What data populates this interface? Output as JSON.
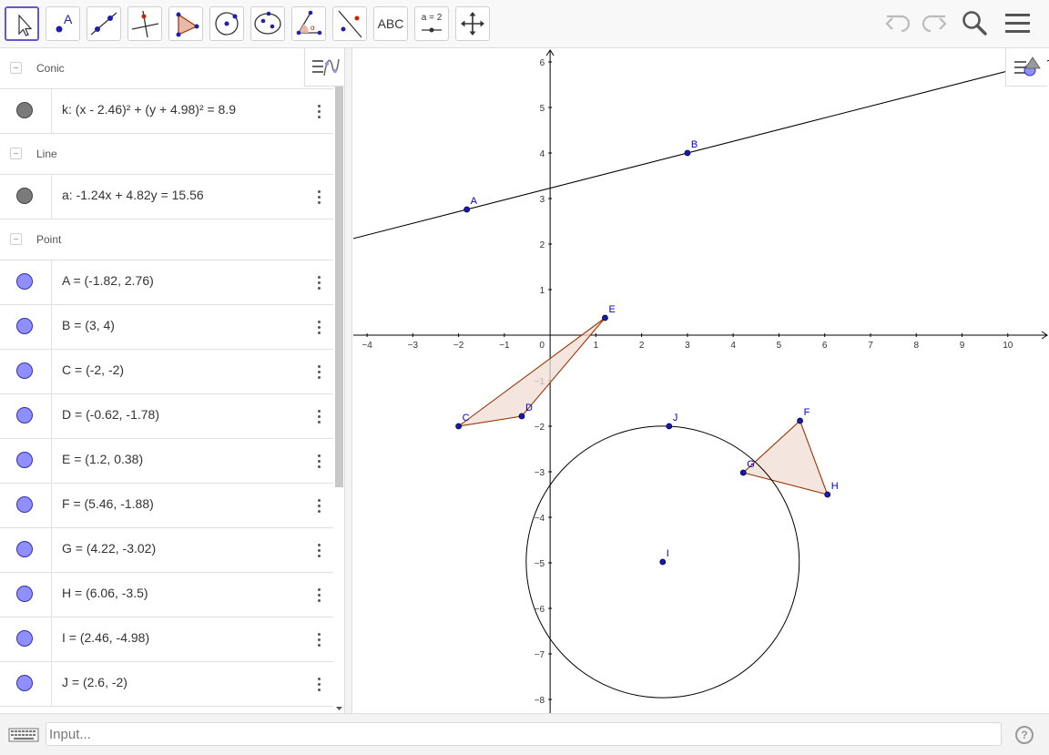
{
  "toolbar": {
    "tools": [
      {
        "name": "move-tool",
        "selected": true
      },
      {
        "name": "point-tool"
      },
      {
        "name": "line-tool"
      },
      {
        "name": "perpendicular-line-tool"
      },
      {
        "name": "polygon-tool"
      },
      {
        "name": "circle-center-point-tool"
      },
      {
        "name": "ellipse-tool"
      },
      {
        "name": "angle-tool"
      },
      {
        "name": "reflect-line-tool"
      },
      {
        "name": "text-tool",
        "label": "ABC"
      },
      {
        "name": "slider-tool",
        "label": "a = 2"
      },
      {
        "name": "move-graphics-view-tool"
      }
    ],
    "icons": {
      "undo": "undo-icon",
      "redo": "redo-icon",
      "search": "search-icon",
      "menu": "menu-icon"
    }
  },
  "algebra": {
    "groups": [
      {
        "title": "Conic",
        "items": [
          {
            "expr": "k: (x - 2.46)² + (y + 4.98)² = 8.9",
            "color": "gray"
          }
        ]
      },
      {
        "title": "Line",
        "items": [
          {
            "expr": "a: -1.24x + 4.82y = 15.56",
            "color": "gray"
          }
        ]
      },
      {
        "title": "Point",
        "items": [
          {
            "expr": "A = (-1.82, 2.76)",
            "color": "blue"
          },
          {
            "expr": "B = (3, 4)",
            "color": "blue"
          },
          {
            "expr": "C = (-2, -2)",
            "color": "blue"
          },
          {
            "expr": "D = (-0.62, -1.78)",
            "color": "blue"
          },
          {
            "expr": "E = (1.2, 0.38)",
            "color": "blue"
          },
          {
            "expr": "F = (5.46, -1.88)",
            "color": "blue"
          },
          {
            "expr": "G = (4.22, -3.02)",
            "color": "blue"
          },
          {
            "expr": "H = (6.06, -3.5)",
            "color": "blue"
          },
          {
            "expr": "I = (2.46, -4.98)",
            "color": "blue"
          },
          {
            "expr": "J = (2.6, -2)",
            "color": "blue"
          }
        ]
      }
    ]
  },
  "graphics": {
    "x_range": [
      -4.3,
      10.9
    ],
    "y_range": [
      -8.3,
      6.3
    ],
    "x_ticks": [
      "−4",
      "−3",
      "−2",
      "−1",
      "0",
      "1",
      "2",
      "3",
      "4",
      "5",
      "6",
      "7",
      "8",
      "9",
      "10"
    ],
    "y_ticks": [
      "6",
      "5",
      "4",
      "3",
      "2",
      "1",
      "−1",
      "−2",
      "−3",
      "−4",
      "−5",
      "−6",
      "−7",
      "−8"
    ],
    "points": [
      {
        "label": "A",
        "x": -1.82,
        "y": 2.76
      },
      {
        "label": "B",
        "x": 3,
        "y": 4
      },
      {
        "label": "C",
        "x": -2,
        "y": -2
      },
      {
        "label": "D",
        "x": -0.62,
        "y": -1.78
      },
      {
        "label": "E",
        "x": 1.2,
        "y": 0.38
      },
      {
        "label": "F",
        "x": 5.46,
        "y": -1.88
      },
      {
        "label": "G",
        "x": 4.22,
        "y": -3.02
      },
      {
        "label": "H",
        "x": 6.06,
        "y": -3.5
      },
      {
        "label": "I",
        "x": 2.46,
        "y": -4.98
      },
      {
        "label": "J",
        "x": 2.6,
        "y": -2
      }
    ],
    "line": {
      "name": "a",
      "through": [
        "A",
        "B"
      ]
    },
    "circle": {
      "name": "k",
      "center": [
        2.46,
        -4.98
      ],
      "r_squared": 8.9
    },
    "polygons": [
      [
        "C",
        "D",
        "E"
      ],
      [
        "G",
        "F",
        "H"
      ]
    ],
    "colors": {
      "point": "#0000cc",
      "point_fill": "#1a1aa8",
      "polygon_stroke": "#993300",
      "polygon_fill": "#f0dcd3",
      "axis": "#000000"
    }
  },
  "input": {
    "placeholder": "Input..."
  },
  "help_label": "?"
}
